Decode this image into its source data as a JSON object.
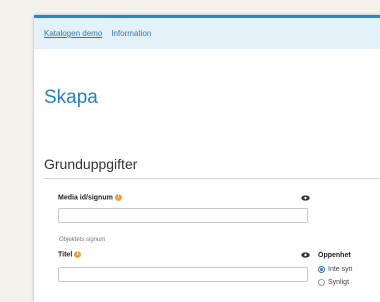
{
  "nav": {
    "links": [
      {
        "label": "Katalogen demo",
        "active": true
      },
      {
        "label": "Information",
        "active": false
      }
    ]
  },
  "page": {
    "title": "Skapa"
  },
  "section": {
    "title": "Grunduppgifter"
  },
  "fields": {
    "media_id": {
      "label": "Media id/signum",
      "value": "",
      "help": "Objektets signum"
    },
    "titel": {
      "label": "Titel",
      "value": ""
    }
  },
  "openness": {
    "label": "Öppenhet",
    "options": [
      {
        "label": "Inte syn",
        "checked": true
      },
      {
        "label": "Synligt",
        "checked": false
      }
    ]
  },
  "icons": {
    "info": "info-icon",
    "eye": "eye-icon"
  },
  "colors": {
    "accent": "#2d86bf",
    "nav_bg": "#e4f1f8",
    "info": "#e8a33a"
  }
}
